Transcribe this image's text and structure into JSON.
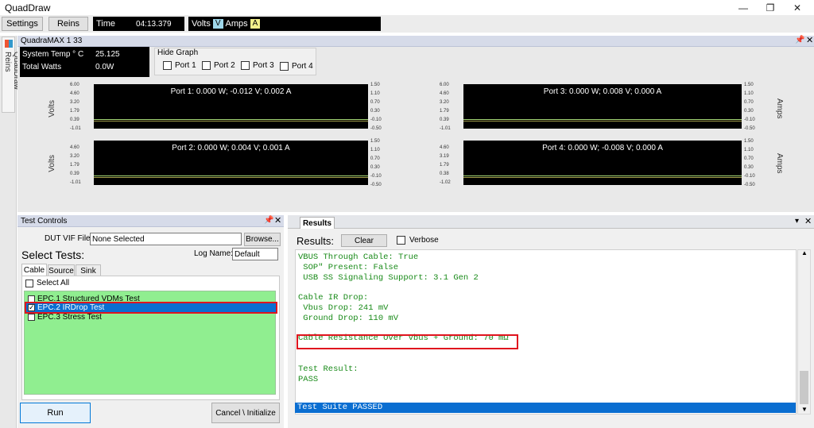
{
  "window": {
    "title": "QuadDraw",
    "minimize_icon": "minimize-icon",
    "maximize_icon": "restore-icon",
    "close_icon": "close-icon"
  },
  "toolbar": {
    "settings_label": "Settings",
    "reins_label": "Reins",
    "time_label": "Time",
    "time_value": "04:13.379",
    "volts_label": "Volts",
    "volts_badge": "V",
    "amps_label": "Amps",
    "amps_badge": "A"
  },
  "dock": {
    "side_tab_label": "QuadDraw Reins"
  },
  "panel": {
    "title": "QuadraMAX 1 33",
    "status": {
      "temp_label": "System Temp ° C",
      "temp_value": "25.125",
      "watts_label": "Total Watts",
      "watts_value": "0.0W"
    },
    "hide_graph": {
      "label": "Hide Graph",
      "ports": [
        "Port 1",
        "Port 2",
        "Port 3",
        "Port 4"
      ]
    },
    "left_axis_label": "Volts",
    "right_axis_label": "Amps",
    "graphs": [
      {
        "title": "Port 1:  0.000 W;  -0.012 V;  0.002 A",
        "left_ticks": [
          "6.00",
          "4.60",
          "3.20",
          "1.79",
          "0.39",
          "-1.01"
        ],
        "right_ticks": [
          "1.50",
          "1.10",
          "0.70",
          "0.30",
          "-0.10",
          "-0.50"
        ]
      },
      {
        "title": "Port 2:  0.000 W;  0.004 V;  0.001 A",
        "left_ticks": [
          "4.60",
          "3.20",
          "1.79",
          "0.39",
          "-1.01"
        ],
        "right_ticks": [
          "1.50",
          "1.10",
          "0.70",
          "0.30",
          "-0.10",
          "-0.50"
        ]
      },
      {
        "title": "Port 3:  0.000 W;  0.008 V;  0.000 A",
        "left_ticks": [
          "6.00",
          "4.60",
          "3.20",
          "1.79",
          "0.39",
          "-1.01"
        ],
        "right_ticks": [
          "1.50",
          "1.10",
          "0.70",
          "0.30",
          "-0.10",
          "-0.50"
        ]
      },
      {
        "title": "Port 4:  0.000 W;  -0.008 V;  0.000 A",
        "left_ticks": [
          "4.60",
          "3.19",
          "1.79",
          "0.38",
          "-1.02"
        ],
        "right_ticks": [
          "1.50",
          "1.10",
          "0.70",
          "0.30",
          "-0.10",
          "-0.50"
        ]
      }
    ]
  },
  "test_controls": {
    "title": "Test Controls",
    "dut_label": "DUT VIF File:",
    "dut_value": "None Selected",
    "browse_label": "Browse...",
    "select_tests_label": "Select Tests:",
    "log_name_label": "Log Name:",
    "log_name_value": "Default",
    "tabs": [
      "Cable",
      "Source",
      "Sink"
    ],
    "select_all_label": "Select All",
    "tests": [
      {
        "label": "EPC.1 Structured VDMs Test",
        "checked": false,
        "selected": false
      },
      {
        "label": "EPC.2 IRDrop Test",
        "checked": true,
        "selected": true
      },
      {
        "label": "EPC.3 Stress Test",
        "checked": false,
        "selected": false
      }
    ],
    "run_label": "Run",
    "cancel_label": "Cancel \\ Initialize"
  },
  "results": {
    "tab_label": "Results",
    "heading": "Results:",
    "clear_label": "Clear",
    "verbose_label": "Verbose",
    "lines": [
      "VBUS Through Cable: True",
      " SOP\" Present: False",
      " USB SS Signaling Support: 3.1 Gen 2",
      "",
      "Cable IR Drop:",
      " Vbus Drop: 241 mV",
      " Ground Drop: 110 mV",
      "",
      "Cable Resistance Over Vbus + Ground: 70 mΩ",
      "",
      "",
      "Test Result:",
      "PASS"
    ],
    "footer_line": "Test Suite PASSED"
  },
  "colors": {
    "test_list_bg": "#90ee90",
    "selection": "#0a6ed1",
    "console_text": "#188a18",
    "highlight_box": "#e0141e"
  }
}
